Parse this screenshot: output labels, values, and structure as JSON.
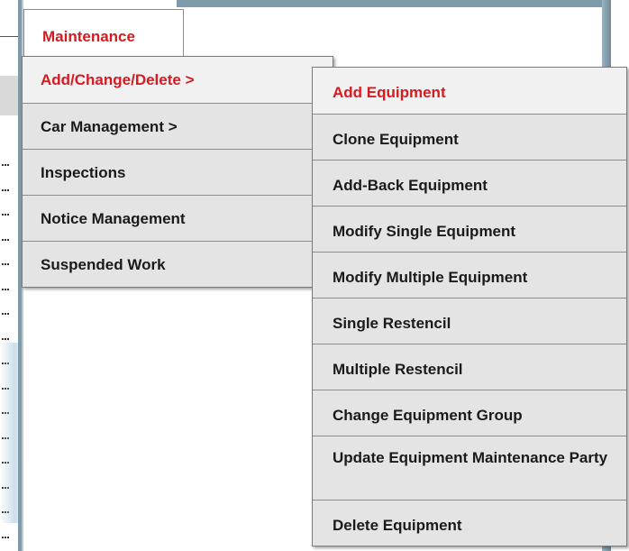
{
  "tab": {
    "label": "Maintenance"
  },
  "menu": {
    "items": [
      {
        "label": "Add/Change/Delete >"
      },
      {
        "label": "Car Management >"
      },
      {
        "label": "Inspections"
      },
      {
        "label": "Notice Management"
      },
      {
        "label": "Suspended Work"
      }
    ]
  },
  "submenu": {
    "items": [
      {
        "label": "Add Equipment"
      },
      {
        "label": "Clone Equipment"
      },
      {
        "label": "Add-Back Equipment"
      },
      {
        "label": "Modify Single Equipment"
      },
      {
        "label": "Modify Multiple Equipment"
      },
      {
        "label": "Single Restencil"
      },
      {
        "label": "Multiple Restencil"
      },
      {
        "label": "Change Equipment Group"
      },
      {
        "label": "Update Equipment Maintenance Party"
      },
      {
        "label": "Delete Equipment"
      }
    ]
  },
  "colors": {
    "active_text": "#d71920",
    "item_bg": "#e4e4e4",
    "frame": "#7f9aa8"
  }
}
